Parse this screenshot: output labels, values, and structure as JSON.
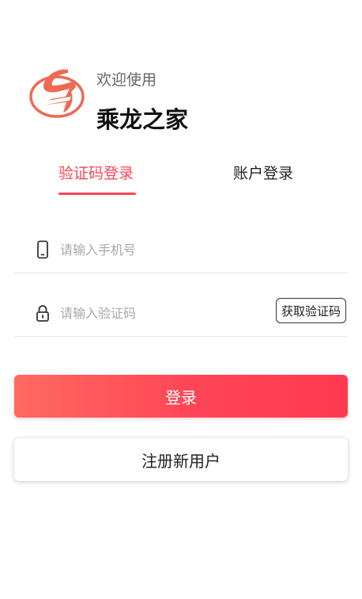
{
  "header": {
    "welcome": "欢迎使用",
    "app_name": "乘龙之家",
    "logo_icon": "dragon-logo-icon"
  },
  "tabs": [
    {
      "label": "验证码登录",
      "active": true
    },
    {
      "label": "账户登录",
      "active": false
    }
  ],
  "form": {
    "phone": {
      "icon": "mobile-phone-icon",
      "value": "",
      "placeholder": "请输入手机号"
    },
    "code": {
      "icon": "lock-icon",
      "value": "",
      "placeholder": "请输入验证码",
      "get_code_label": "获取验证码"
    }
  },
  "buttons": {
    "login_label": "登录",
    "register_label": "注册新用户"
  },
  "colors": {
    "accent": "#ff4455",
    "logo_orange": "#ee6a52",
    "text": "#222222",
    "placeholder": "#a8a8a8"
  }
}
